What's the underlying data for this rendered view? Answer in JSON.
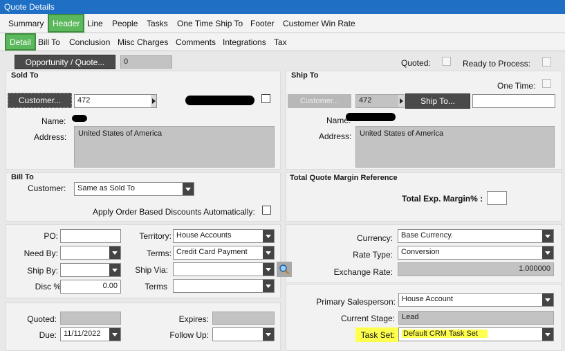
{
  "window": {
    "title": "Quote Details"
  },
  "tabs_main": [
    "Summary",
    "Header",
    "Line",
    "People",
    "Tasks",
    "One Time Ship To",
    "Footer",
    "Customer Win Rate"
  ],
  "tabs_sub": [
    "Detail",
    "Bill To",
    "Conclusion",
    "Misc Charges",
    "Comments",
    "Integrations",
    "Tax"
  ],
  "top": {
    "opportunity_button": "Opportunity / Quote...",
    "opportunity_value": "0",
    "quoted_label": "Quoted:",
    "ready_label": "Ready to Process:"
  },
  "sold_to": {
    "title": "Sold To",
    "customer_button": "Customer...",
    "customer_id": "472",
    "name_label": "Name:",
    "address_label": "Address:",
    "address": "United States of America"
  },
  "ship_to": {
    "title": "Ship To",
    "one_time_label": "One Time:",
    "customer_button": "Customer...",
    "customer_id": "472",
    "ship_to_button": "Ship To...",
    "ship_to_value": "",
    "name_label": "Name:",
    "address_label": "Address:",
    "address": "United States of America"
  },
  "bill_to": {
    "title": "Bill To",
    "customer_label": "Customer:",
    "customer_value": "Same as Sold To",
    "discounts_label": "Apply Order Based Discounts Automatically:"
  },
  "margin": {
    "title": "Total Quote Margin Reference",
    "label": "Total Exp. Margin% :",
    "value": ""
  },
  "order": {
    "po_label": "PO:",
    "po_value": "",
    "need_by_label": "Need By:",
    "need_by_value": "",
    "ship_by_label": "Ship By:",
    "ship_by_value": "",
    "disc_label": "Disc %",
    "disc_value": "0.00",
    "territory_label": "Territory:",
    "territory_value": "House Accounts",
    "terms_label": "Terms:",
    "terms_value": "Credit Card Payment",
    "ship_via_label": "Ship Via:",
    "ship_via_value": "",
    "terms2_label": "Terms",
    "terms2_value": "",
    "currency_label": "Currency:",
    "currency_value": "Base Currency.",
    "rate_type_label": "Rate Type:",
    "rate_type_value": "Conversion",
    "exchange_label": "Exchange Rate:",
    "exchange_value": "1.000000"
  },
  "dates": {
    "quoted_label": "Quoted:",
    "quoted_value": "",
    "expires_label": "Expires:",
    "expires_value": "",
    "due_label": "Due:",
    "due_value": "11/11/2022",
    "follow_up_label": "Follow Up:",
    "follow_up_value": ""
  },
  "sales": {
    "salesperson_label": "Primary Salesperson:",
    "salesperson_value": "House Account",
    "stage_label": "Current Stage:",
    "stage_value": "Lead",
    "task_set_label": "Task Set:",
    "task_set_value": "Default CRM Task Set"
  },
  "colors": {
    "active_tab": "#5cb85c",
    "titlebar": "#1f6fc4",
    "highlight": "#ffff4d"
  }
}
